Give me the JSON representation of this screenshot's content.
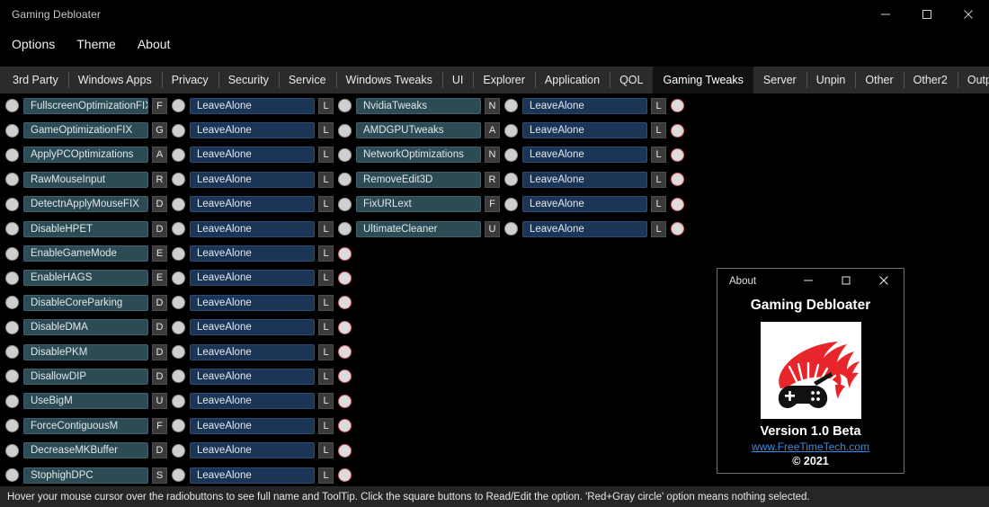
{
  "window": {
    "title": "Gaming Debloater",
    "controls": [
      {
        "name": "minimize",
        "glyph": "minimize-icon"
      },
      {
        "name": "maximize",
        "glyph": "maximize-icon"
      },
      {
        "name": "close",
        "glyph": "close-icon"
      }
    ]
  },
  "menubar": {
    "items": [
      {
        "label": "Options"
      },
      {
        "label": "Theme"
      },
      {
        "label": "About"
      }
    ]
  },
  "tabs": {
    "selected": "Gaming Tweaks",
    "items": [
      {
        "label": "3rd Party"
      },
      {
        "label": "Windows Apps"
      },
      {
        "label": "Privacy"
      },
      {
        "label": "Security"
      },
      {
        "label": "Service"
      },
      {
        "label": "Windows Tweaks"
      },
      {
        "label": "UI"
      },
      {
        "label": "Explorer"
      },
      {
        "label": "Application"
      },
      {
        "label": "QOL"
      },
      {
        "label": "Gaming Tweaks"
      },
      {
        "label": "Server"
      },
      {
        "label": "Unpin"
      },
      {
        "label": "Other"
      },
      {
        "label": "Other2"
      },
      {
        "label": "Output"
      }
    ]
  },
  "options": {
    "value_label": "LeaveAlone",
    "value_key": "L",
    "left_column": [
      {
        "name": "FullscreenOptimizationFIX",
        "key": "F",
        "value": "LeaveAlone",
        "value_key": "L",
        "status": "red-gray",
        "extra_circle": true
      },
      {
        "name": "GameOptimizationFIX",
        "key": "G",
        "value": "LeaveAlone",
        "value_key": "L",
        "status": "red-gray",
        "extra_circle": true
      },
      {
        "name": "ApplyPCOptimizations",
        "key": "A",
        "value": "LeaveAlone",
        "value_key": "L",
        "status": "red-gray",
        "extra_circle": true
      },
      {
        "name": "RawMouseInput",
        "key": "R",
        "value": "LeaveAlone",
        "value_key": "L",
        "status": "red-gray",
        "extra_circle": true
      },
      {
        "name": "DetectnApplyMouseFIX",
        "key": "D",
        "value": "LeaveAlone",
        "value_key": "L",
        "status": "red-gray",
        "extra_circle": true
      },
      {
        "name": "DisableHPET",
        "key": "D",
        "value": "LeaveAlone",
        "value_key": "L",
        "status": "red-gray",
        "extra_circle": true
      },
      {
        "name": "EnableGameMode",
        "key": "E",
        "value": "LeaveAlone",
        "value_key": "L",
        "status": "red-gray",
        "extra_circle": false
      },
      {
        "name": "EnableHAGS",
        "key": "E",
        "value": "LeaveAlone",
        "value_key": "L",
        "status": "red-gray",
        "extra_circle": false
      },
      {
        "name": "DisableCoreParking",
        "key": "D",
        "value": "LeaveAlone",
        "value_key": "L",
        "status": "red-gray",
        "extra_circle": false
      },
      {
        "name": "DisableDMA",
        "key": "D",
        "value": "LeaveAlone",
        "value_key": "L",
        "status": "red-gray",
        "extra_circle": false
      },
      {
        "name": "DisablePKM",
        "key": "D",
        "value": "LeaveAlone",
        "value_key": "L",
        "status": "red-gray",
        "extra_circle": false
      },
      {
        "name": "DisallowDIP",
        "key": "D",
        "value": "LeaveAlone",
        "value_key": "L",
        "status": "red-gray",
        "extra_circle": false
      },
      {
        "name": "UseBigM",
        "key": "U",
        "value": "LeaveAlone",
        "value_key": "L",
        "status": "red-gray",
        "extra_circle": false
      },
      {
        "name": "ForceContiguousM",
        "key": "F",
        "value": "LeaveAlone",
        "value_key": "L",
        "status": "red-gray",
        "extra_circle": false
      },
      {
        "name": "DecreaseMKBuffer",
        "key": "D",
        "value": "LeaveAlone",
        "value_key": "L",
        "status": "red-gray",
        "extra_circle": false
      },
      {
        "name": "StophighDPC",
        "key": "S",
        "value": "LeaveAlone",
        "value_key": "L",
        "status": "red-gray",
        "extra_circle": false
      }
    ],
    "right_column": [
      {
        "name": "NvidiaTweaks",
        "key": "N",
        "value": "LeaveAlone",
        "value_key": "L",
        "status": "red-gray"
      },
      {
        "name": "AMDGPUTweaks",
        "key": "A",
        "value": "LeaveAlone",
        "value_key": "L",
        "status": "red-gray"
      },
      {
        "name": "NetworkOptimizations",
        "key": "N",
        "value": "LeaveAlone",
        "value_key": "L",
        "status": "red-gray"
      },
      {
        "name": "RemoveEdit3D",
        "key": "R",
        "value": "LeaveAlone",
        "value_key": "L",
        "status": "red-gray"
      },
      {
        "name": "FixURLext",
        "key": "F",
        "value": "LeaveAlone",
        "value_key": "L",
        "status": "red-gray"
      },
      {
        "name": "UltimateCleaner",
        "key": "U",
        "value": "LeaveAlone",
        "value_key": "L",
        "status": "red-gray"
      }
    ]
  },
  "about_dialog": {
    "title": "About",
    "app_name": "Gaming Debloater",
    "version": "Version 1.0 Beta",
    "link": "www.FreeTimeTech.com",
    "copyright": "© 2021",
    "logo": "flame-gamepad-logo",
    "controls": [
      {
        "name": "minimize",
        "glyph": "minimize-icon"
      },
      {
        "name": "maximize",
        "glyph": "maximize-icon"
      },
      {
        "name": "close",
        "glyph": "close-icon"
      }
    ]
  },
  "statusbar": {
    "text": "Hover your mouse cursor over the radiobuttons to see full name and ToolTip. Click the square buttons to Read/Edit the option. 'Red+Gray circle' option means nothing selected."
  },
  "colors": {
    "window_bg": "#000000",
    "tabstrip_bg": "#2b2b2b",
    "tab_selected_bg": "#111111",
    "namebox_teal": "#2d4b54",
    "namebox_blue": "#1b3557",
    "square_button": "#3a3a3a",
    "radio_gray": "#cfcfcf",
    "radio_red_ring": "#d9626b",
    "statusbar_bg": "#262626",
    "link_blue": "#3b8bdc",
    "logo_red": "#e8252b"
  }
}
